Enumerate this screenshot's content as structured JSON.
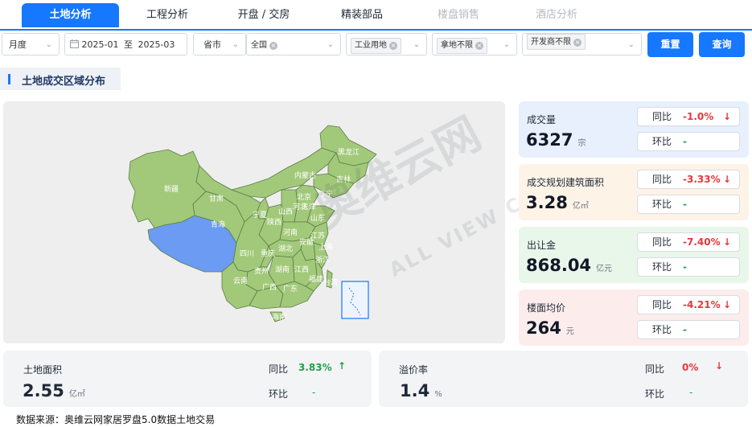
{
  "tabs": [
    {
      "label": "土地分析",
      "state": "active"
    },
    {
      "label": "工程分析",
      "state": "normal"
    },
    {
      "label": "开盘 / 交房",
      "state": "normal"
    },
    {
      "label": "精装部品",
      "state": "normal"
    },
    {
      "label": "楼盘销售",
      "state": "disabled"
    },
    {
      "label": "酒店分析",
      "state": "disabled"
    }
  ],
  "filters": {
    "period": "月度",
    "date_start": "2025-01",
    "date_sep": "至",
    "date_end": "2025-03",
    "region_level": "省市",
    "region": "全国",
    "land_use": "工业用地",
    "acquirer": "拿地不限",
    "developer": "开发商不限",
    "reset_label": "重置",
    "query_label": "查询"
  },
  "section": {
    "title": "土地成交区域分布"
  },
  "map": {
    "highlight_color": "#6b9bf2",
    "base_color": "#a2c97a",
    "provinces": [
      "新疆",
      "甘肃",
      "青海",
      "内蒙古",
      "黑龙江",
      "吉林",
      "辽宁",
      "北京",
      "天津",
      "宁夏",
      "山西",
      "河北",
      "陕西",
      "山东",
      "河南",
      "江苏",
      "安徽",
      "湖北",
      "上海",
      "四川",
      "重庆",
      "浙江",
      "湖南",
      "江西",
      "贵州",
      "福建",
      "云南",
      "广西",
      "广东",
      "台湾",
      "海南"
    ]
  },
  "watermark": {
    "brand": "奥维云网",
    "sub": "ALL VIEW CLOUD"
  },
  "stats": [
    {
      "label": "成交量",
      "value": "6327",
      "unit": "宗",
      "yoy_label": "同比",
      "yoy": "-1.0%",
      "yoy_dir": "down",
      "mom_label": "环比",
      "mom": "-",
      "bg": "#e8effd"
    },
    {
      "label": "成交规划建筑面积",
      "value": "3.28",
      "unit": "亿㎡",
      "yoy_label": "同比",
      "yoy": "-3.33%",
      "yoy_dir": "down",
      "mom_label": "环比",
      "mom": "-",
      "bg": "#fdf3e6"
    },
    {
      "label": "出让金",
      "value": "868.04",
      "unit": "亿元",
      "yoy_label": "同比",
      "yoy": "-7.40%",
      "yoy_dir": "down",
      "mom_label": "环比",
      "mom": "-",
      "bg": "#e9f6ea"
    },
    {
      "label": "楼面均价",
      "value": "264",
      "unit": "元",
      "yoy_label": "同比",
      "yoy": "-4.21%",
      "yoy_dir": "down",
      "mom_label": "环比",
      "mom": "-",
      "bg": "#fdecec"
    }
  ],
  "bottom": [
    {
      "label": "土地面积",
      "value": "2.55",
      "unit": "亿㎡",
      "yoy_label": "同比",
      "yoy": "3.83%",
      "yoy_dir": "up",
      "mom_label": "环比",
      "mom": "-"
    },
    {
      "label": "溢价率",
      "value": "1.4",
      "unit": "%",
      "yoy_label": "同比",
      "yoy": "0%",
      "yoy_dir": "down",
      "mom_label": "环比",
      "mom": "-"
    }
  ],
  "source": "数据来源：奥维云网家居罗盘5.0数据土地交易"
}
